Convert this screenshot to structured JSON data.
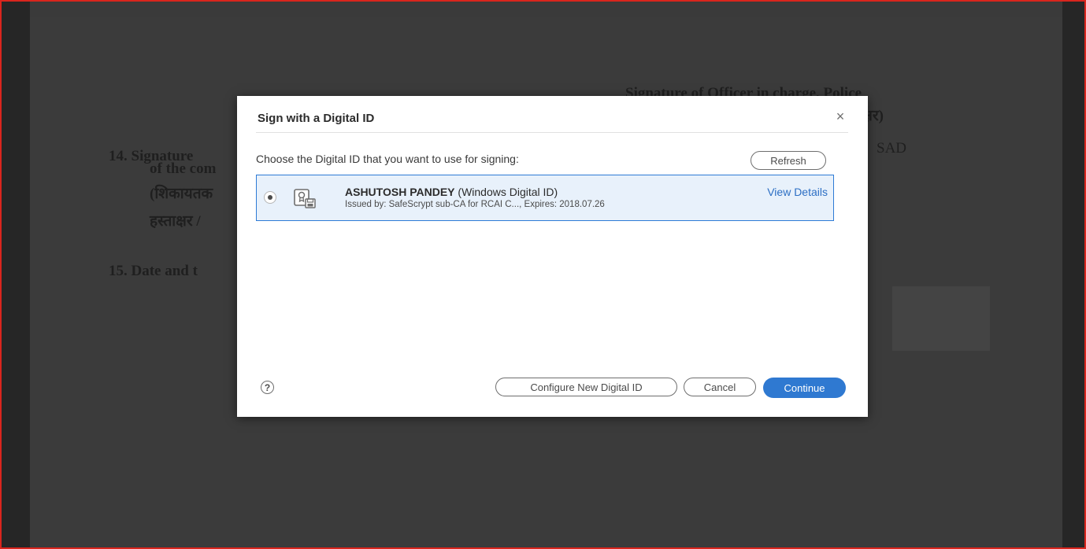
{
  "document": {
    "officer_signature_line1": "Signature of Officer in charge, Police",
    "officer_signature_line2": "ाक्षर)",
    "officer_name_fragment": "SAD",
    "item14_line1": "14.  Signature",
    "item14_line2": "of the com",
    "item14_line3": "(शिकायतक",
    "item14_line4": "हस्ताक्षर  /",
    "item15": "15.  Date and t"
  },
  "dialog": {
    "title": "Sign with a Digital ID",
    "close_symbol": "×",
    "prompt": "Choose the Digital ID that you want to use for signing:",
    "refresh_label": "Refresh",
    "digital_id": {
      "name": "ASHUTOSH PANDEY",
      "type": "(Windows Digital ID)",
      "issued": "Issued by: SafeScrypt sub-CA for RCAI C..., Expires: 2018.07.26",
      "view_details_label": "View Details",
      "selected": true
    },
    "help_symbol": "?",
    "configure_label": "Configure New Digital ID",
    "cancel_label": "Cancel",
    "continue_label": "Continue"
  },
  "colors": {
    "frame_border": "#d9251d",
    "accent": "#2f79d1",
    "selected_row_bg": "#e8f1fb"
  }
}
